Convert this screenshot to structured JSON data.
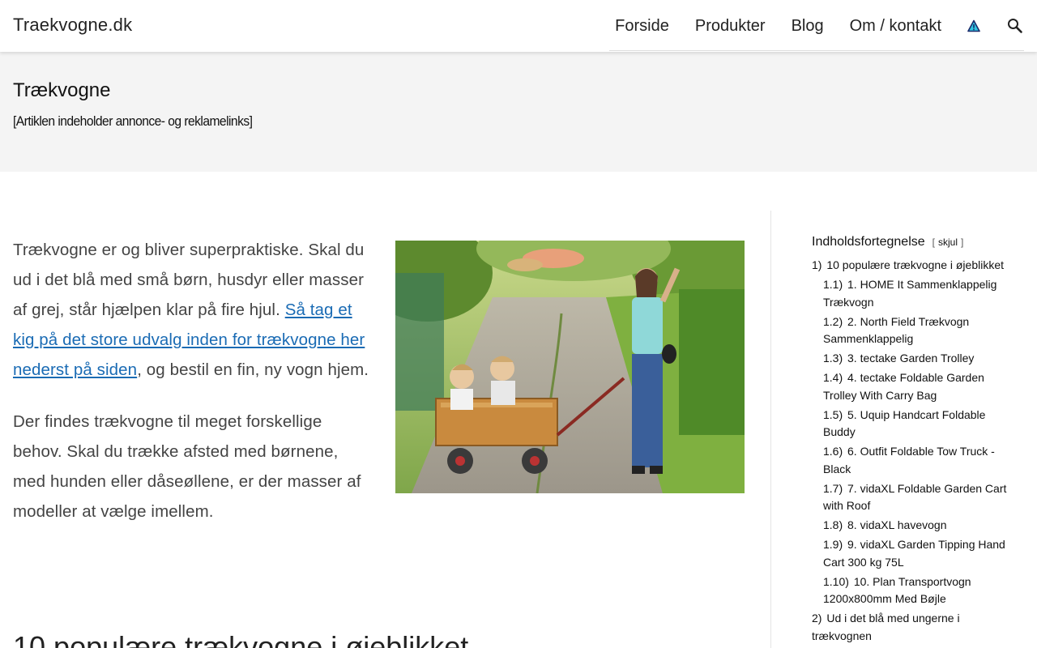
{
  "header": {
    "site_title": "Traekvogne.dk",
    "nav": [
      "Forside",
      "Produkter",
      "Blog",
      "Om / kontakt"
    ],
    "icons": [
      "warning-icon",
      "search-icon"
    ]
  },
  "title_band": {
    "title": "Trækvogne",
    "disclaimer": "[Artiklen indeholder annonce- og reklamelinks]"
  },
  "article": {
    "p1_text": "Trækvogne er og bliver superpraktiske. Skal du ud i det blå med små børn, husdyr eller masser af grej, står hjælpen klar på fire hjul. ",
    "p1_link": "Så tag et kig på det store udvalg inden for trækvogne her nederst på siden",
    "p1_tail": ", og bestil en fin, ny vogn hjem.",
    "p2": "Der findes trækvogne til meget forskellige behov. Skal du trække afsted med børnene, med hunden eller dåseøllene, er der masser af modeller at vælge imellem.",
    "section_heading": "10 populære trækvogne i øjeblikket"
  },
  "toc": {
    "title": "Indholdsfortegnelse",
    "toggle_label": "skjul",
    "items": [
      {
        "num": "1)",
        "text": "10 populære trækvogne i øjeblikket",
        "level": 1
      },
      {
        "num": "1.1)",
        "text": "1. HOME It Sammenklappelig Trækvogn",
        "level": 2
      },
      {
        "num": "1.2)",
        "text": "2. North Field Trækvogn Sammenklappelig",
        "level": 2
      },
      {
        "num": "1.3)",
        "text": "3. tectake Garden Trolley",
        "level": 2
      },
      {
        "num": "1.4)",
        "text": "4. tectake Foldable Garden Trolley With Carry Bag",
        "level": 2
      },
      {
        "num": "1.5)",
        "text": "5. Uquip Handcart Foldable Buddy",
        "level": 2
      },
      {
        "num": "1.6)",
        "text": "6. Outfit Foldable Tow Truck - Black",
        "level": 2
      },
      {
        "num": "1.7)",
        "text": "7. vidaXL Foldable Garden Cart with Roof",
        "level": 2
      },
      {
        "num": "1.8)",
        "text": "8. vidaXL havevogn",
        "level": 2
      },
      {
        "num": "1.9)",
        "text": "9. vidaXL Garden Tipping Hand Cart 300 kg 75L",
        "level": 2
      },
      {
        "num": "1.10)",
        "text": "10. Plan Transportvogn 1200x800mm Med Bøjle",
        "level": 2
      },
      {
        "num": "2)",
        "text": "Ud i det blå med ungerne i trækvognen",
        "level": 1
      }
    ]
  },
  "colors": {
    "link": "#1a6bb4",
    "title_band_bg": "#f4f4f4"
  }
}
